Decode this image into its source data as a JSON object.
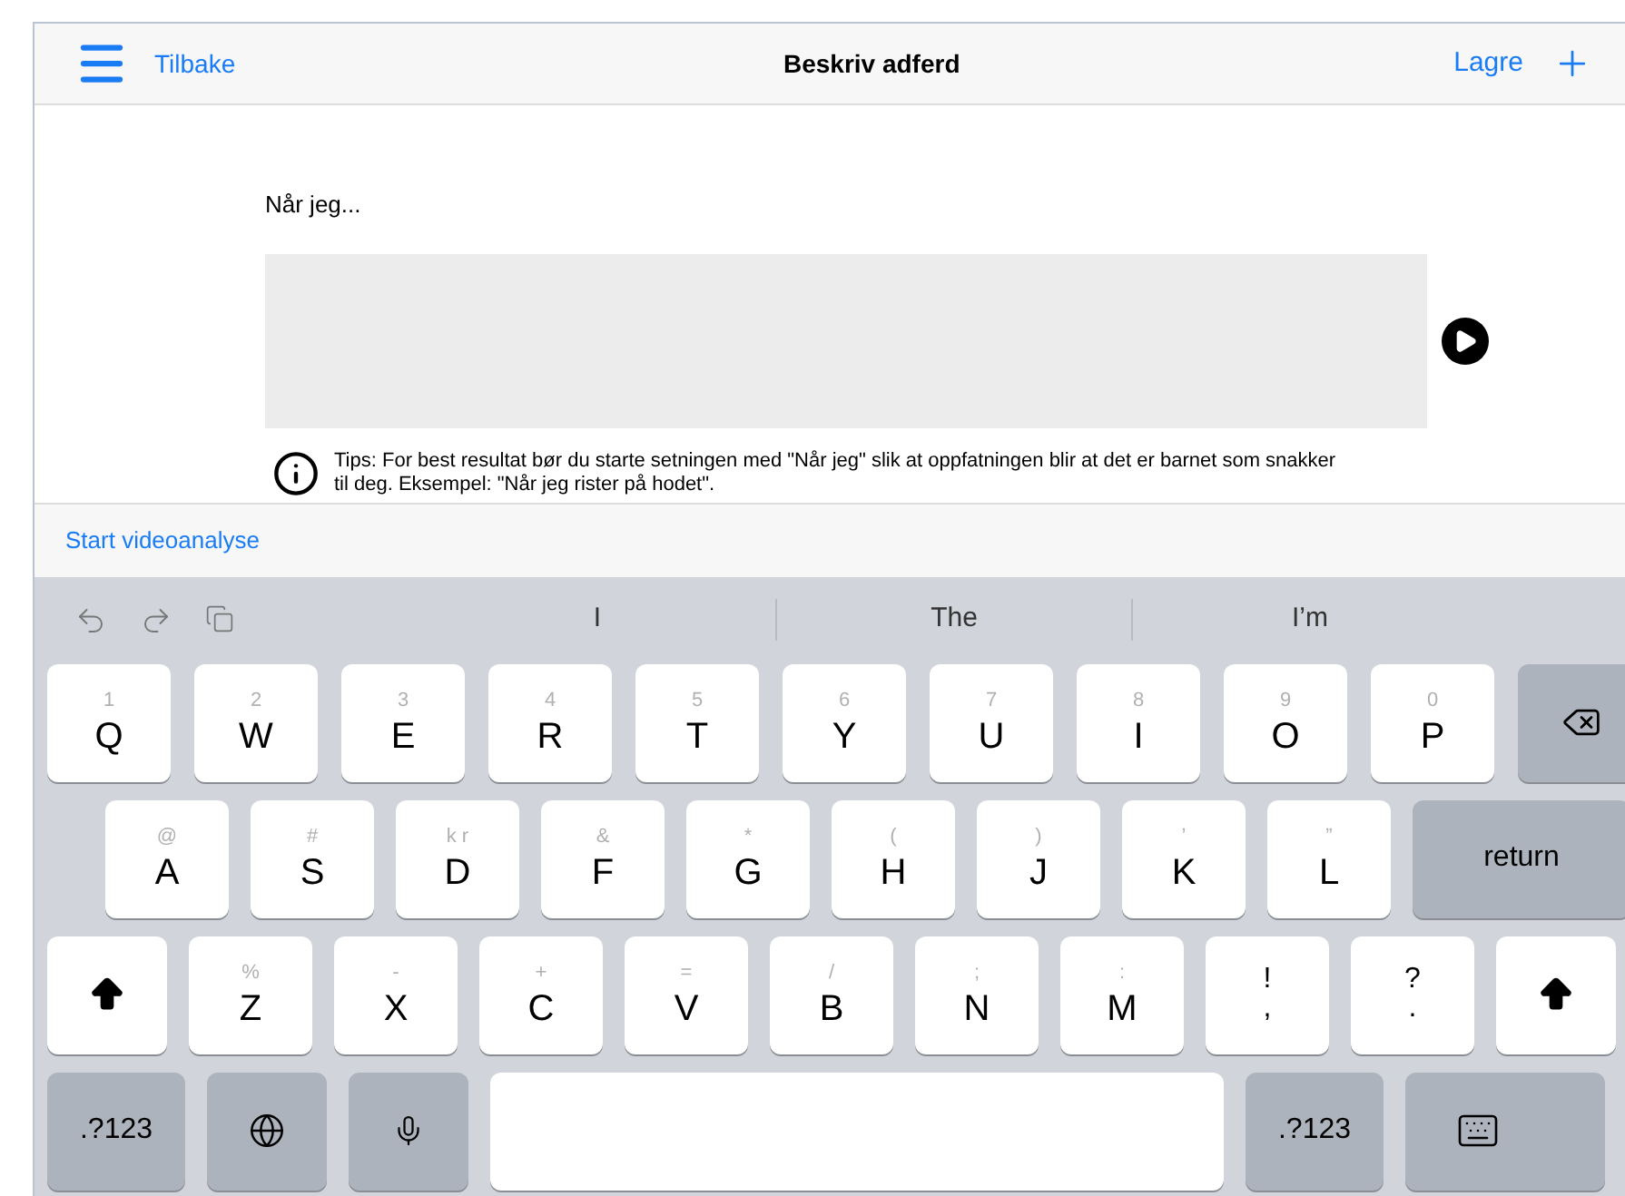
{
  "nav_bar": {
    "back_label": "Tilbake",
    "title": "Beskriv adferd",
    "save_label": "Lagre"
  },
  "prompt_label": "Når jeg...",
  "tip": "Tips: For best resultat bør du starte setningen med \"Når jeg\" slik at oppfatningen blir at det er barnet som snakker til deg. Eksempel: \"Når jeg rister på hodet\".",
  "video_link": "Start videoanalyse",
  "suggestions": [
    {
      "text": "I"
    },
    {
      "text": "The"
    },
    {
      "text": "I’m"
    }
  ],
  "keyboard": {
    "rows": [
      [
        {
          "kind": "char",
          "alt": "1",
          "label": "Q"
        },
        {
          "kind": "char",
          "alt": "2",
          "label": "W"
        },
        {
          "kind": "char",
          "alt": "3",
          "label": "E"
        },
        {
          "kind": "char",
          "alt": "4",
          "label": "R"
        },
        {
          "kind": "char",
          "alt": "5",
          "label": "T"
        },
        {
          "kind": "char",
          "alt": "6",
          "label": "Y"
        },
        {
          "kind": "char",
          "alt": "7",
          "label": "U"
        },
        {
          "kind": "char",
          "alt": "8",
          "label": "I"
        },
        {
          "kind": "char",
          "alt": "9",
          "label": "O"
        },
        {
          "kind": "char",
          "alt": "0",
          "label": "P"
        },
        {
          "kind": "backspace"
        }
      ],
      [
        {
          "kind": "char",
          "alt": "@",
          "label": "A"
        },
        {
          "kind": "char",
          "alt": "#",
          "label": "S"
        },
        {
          "kind": "char",
          "alt": "k r",
          "label": "D"
        },
        {
          "kind": "char",
          "alt": "&",
          "label": "F"
        },
        {
          "kind": "char",
          "alt": "*",
          "label": "G"
        },
        {
          "kind": "char",
          "alt": "(",
          "label": "H"
        },
        {
          "kind": "char",
          "alt": ")",
          "label": "J"
        },
        {
          "kind": "char",
          "alt": "’",
          "label": "K"
        },
        {
          "kind": "char",
          "alt": "”",
          "label": "L"
        },
        {
          "kind": "return",
          "label": "return"
        }
      ],
      [
        {
          "kind": "shift"
        },
        {
          "kind": "char",
          "alt": "%",
          "label": "Z"
        },
        {
          "kind": "char",
          "alt": "-",
          "label": "X"
        },
        {
          "kind": "char",
          "alt": "+",
          "label": "C"
        },
        {
          "kind": "char",
          "alt": "=",
          "label": "V"
        },
        {
          "kind": "char",
          "alt": "/",
          "label": "B"
        },
        {
          "kind": "char",
          "alt": ";",
          "label": "N"
        },
        {
          "kind": "char",
          "alt": ":",
          "label": "M"
        },
        {
          "kind": "punct",
          "alt": "!",
          "label": ","
        },
        {
          "kind": "punct",
          "alt": "?",
          "label": "."
        },
        {
          "kind": "shift"
        }
      ]
    ],
    "bottom_row": [
      {
        "kind": "numbers",
        "label": ".?123"
      },
      {
        "kind": "globe"
      },
      {
        "kind": "mic"
      },
      {
        "kind": "space"
      },
      {
        "kind": "numbers",
        "label": ".?123"
      },
      {
        "kind": "hide"
      }
    ]
  }
}
